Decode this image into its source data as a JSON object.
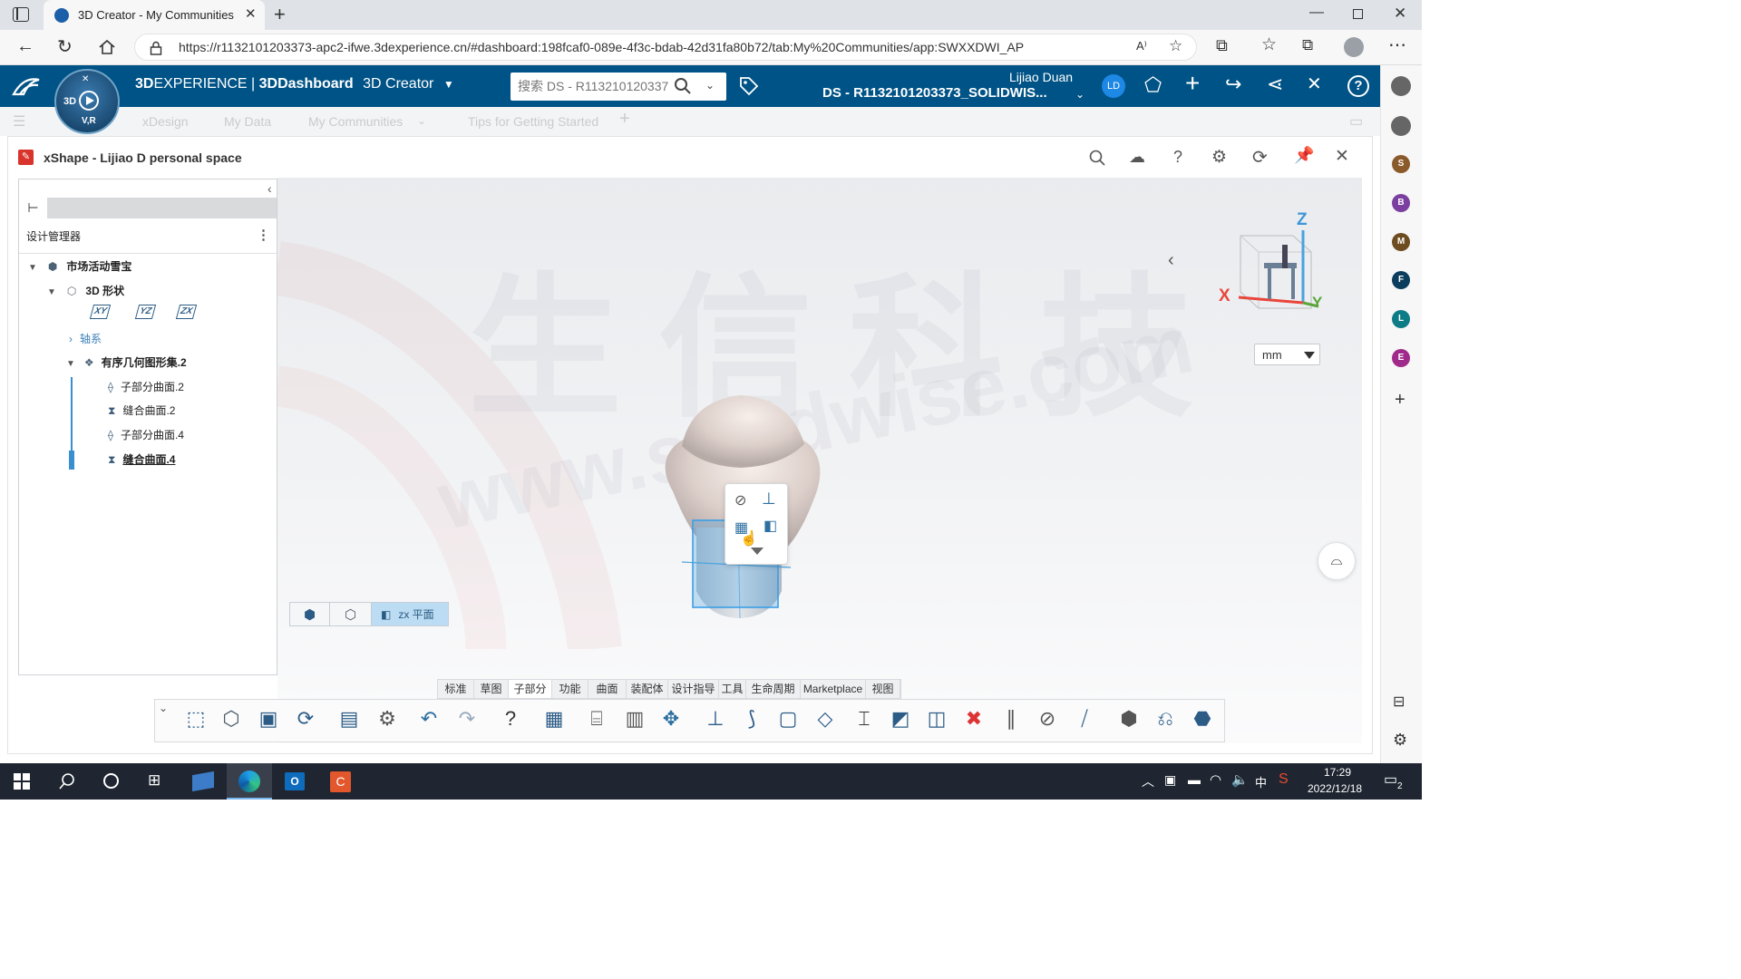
{
  "browser": {
    "tab_title": "3D Creator - My Communities",
    "url": "https://r1132101203373-apc2-ifwe.3dexperience.cn/#dashboard:198fcaf0-089e-4f3c-bdab-42d31fa80b72/tab:My%20Communities/app:SWXXDWI_AP"
  },
  "topbar": {
    "brand_3d": "3D",
    "brand_experience": "EXPERIENCE",
    "brand_sep": " | ",
    "brand_dashboard": "3DDashboard",
    "app_name": "3D Creator",
    "search_placeholder": "搜索 DS - R113210120337",
    "user_name": "Lijiao Duan",
    "tenant": "DS - R1132101203373_SOLIDWIS...",
    "avatar_initials": "LD",
    "compass_labels": [
      "3D",
      "V,R"
    ]
  },
  "navbar": {
    "tabs": [
      "xDesign",
      "My Data",
      "My Communities",
      "Tips for Getting Started"
    ],
    "active_tab": "My Communities"
  },
  "app": {
    "title": "xShape - Lijiao D personal space"
  },
  "panel": {
    "header": "设计管理器",
    "tree": {
      "root": "市场活动雪宝",
      "shape": "3D 形状",
      "planes": [
        "XY",
        "YZ",
        "ZX"
      ],
      "axis": "轴系",
      "geoset": "有序几何图形集.2",
      "children": [
        "子部分曲面.2",
        "缝合曲面.2",
        "子部分曲面.4",
        "缝合曲面.4"
      ]
    }
  },
  "viewport": {
    "unit": "mm",
    "plane_label": "zx 平面",
    "watermark_cn": "生信科技",
    "watermark_en": "www.solidwise.com",
    "triad": {
      "x": "X",
      "y": "Y",
      "z": "Z"
    }
  },
  "action_bar": {
    "categories": [
      "标准",
      "草图",
      "子部分",
      "功能",
      "曲面",
      "装配体",
      "设计指导",
      "工具",
      "生命周期",
      "Marketplace",
      "视图"
    ],
    "active_category": "子部分",
    "icons": [
      "new-part-icon",
      "open-icon",
      "save-icon",
      "refresh-icon",
      "properties-icon",
      "settings-icon",
      "undo-icon",
      "redo-icon",
      "help-icon",
      "grid-plane-icon",
      "cylinder-icon",
      "lattice-icon",
      "symmetry-icon",
      "plane-icon",
      "bend-icon",
      "frame-icon",
      "face-icon",
      "box-frame-icon",
      "surface-icon",
      "shape-icon",
      "remove-icon",
      "strands-icon",
      "sphere-icon",
      "sweep-icon",
      "cube-icon",
      "mirror-icon",
      "assembly-icon"
    ]
  },
  "right_sidebar": {
    "avatars": [
      {
        "letter": "S",
        "color": "#8b5a2b"
      },
      {
        "letter": "B",
        "color": "#7b3fa0"
      },
      {
        "letter": "M",
        "color": "#6d4c1f"
      },
      {
        "letter": "F",
        "color": "#0b3d5c"
      },
      {
        "letter": "L",
        "color": "#0e7c86"
      },
      {
        "letter": "E",
        "color": "#a02a8a"
      }
    ]
  },
  "taskbar": {
    "time": "17:29",
    "date": "2022/12/18",
    "ime": "中",
    "notif_count": "2"
  },
  "colors": {
    "topbar": "#005386",
    "accent": "#368ec4",
    "selection": "#4aa3df"
  }
}
